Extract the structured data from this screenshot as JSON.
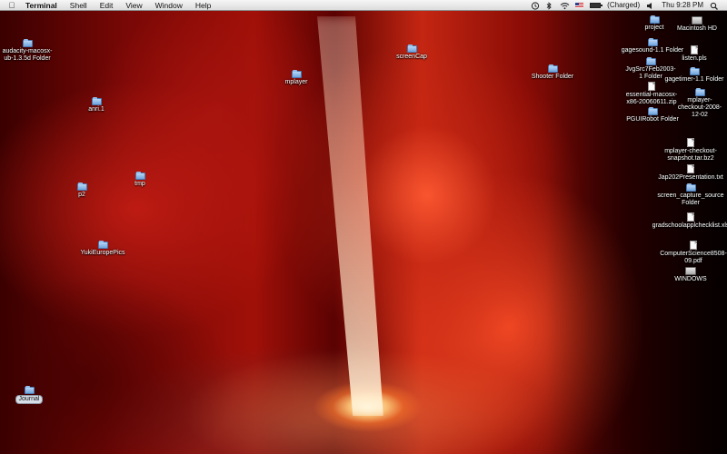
{
  "menubar": {
    "apple_icon": "apple-logo-icon",
    "app_name": "Terminal",
    "menus": [
      "Shell",
      "Edit",
      "View",
      "Window",
      "Help"
    ],
    "status": {
      "battery_label": "(Charged)",
      "battery_level": 1.0,
      "clock": "Thu 9:28 PM"
    }
  },
  "desktop": {
    "icons": [
      {
        "name": "audacity-macosx-ub-1.3.5d Folder",
        "type": "folder"
      },
      {
        "name": "anri.1",
        "type": "folder"
      },
      {
        "name": "p2",
        "type": "folder"
      },
      {
        "name": "tmp",
        "type": "folder"
      },
      {
        "name": "YukiEuropePics",
        "type": "folder"
      },
      {
        "name": "Journal",
        "type": "folder"
      },
      {
        "name": "mplayer",
        "type": "folder"
      },
      {
        "name": "screenCap",
        "type": "folder"
      },
      {
        "name": "Shooter Folder",
        "type": "folder"
      },
      {
        "name": "project",
        "type": "folder"
      },
      {
        "name": "Macintosh HD",
        "type": "disk"
      },
      {
        "name": "gagesound-1.1 Folder",
        "type": "folder"
      },
      {
        "name": "listen.pls",
        "type": "document"
      },
      {
        "name": "JvgSrc7Feb2003-1 Folder",
        "type": "folder"
      },
      {
        "name": "gagetimer-1.1 Folder",
        "type": "folder"
      },
      {
        "name": "essential-macosx-x86-20060611.zip",
        "type": "document"
      },
      {
        "name": "mplayer-checkout-2008-12-02",
        "type": "folder"
      },
      {
        "name": "PGUIRobot Folder",
        "type": "folder"
      },
      {
        "name": "mplayer-checkout-snapshot.tar.bz2",
        "type": "document"
      },
      {
        "name": "Jap202Presentation.txt",
        "type": "document"
      },
      {
        "name": "screen_capture_source Folder",
        "type": "folder"
      },
      {
        "name": "gradschoolapplchecklist.xls",
        "type": "document"
      },
      {
        "name": "ComputerScience8508-09.pdf",
        "type": "document"
      },
      {
        "name": "WINDOWS",
        "type": "disk"
      }
    ]
  }
}
